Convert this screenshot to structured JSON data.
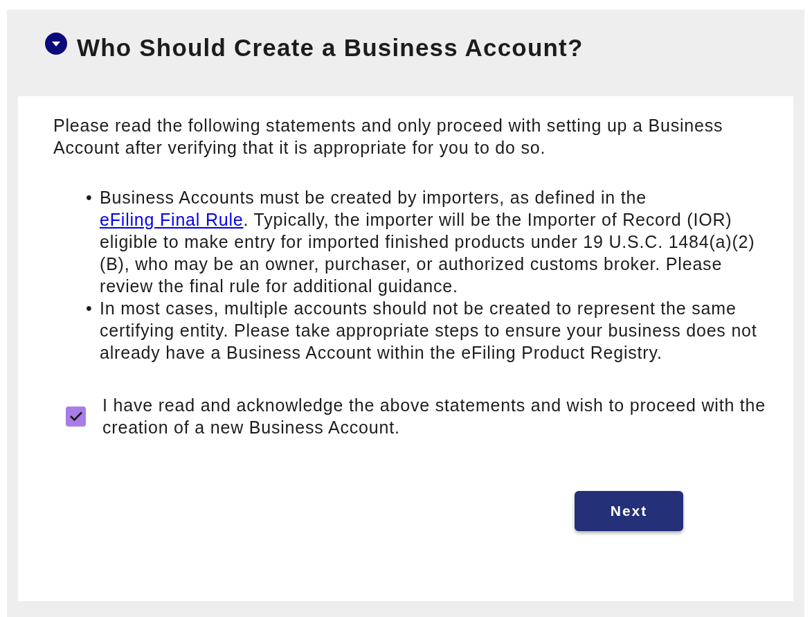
{
  "section": {
    "title": "Who Should Create a Business Account?",
    "expanded": true
  },
  "intro": "Please read the following statements and only proceed with setting up a Business Account after verifying that it is appropriate for you to do so.",
  "statements": [
    {
      "marker": "•",
      "segments": [
        {
          "kind": "text",
          "text": "Business Accounts must be created by importers, as defined in the "
        },
        {
          "kind": "link",
          "text": "eFiling Final Rule"
        },
        {
          "kind": "text",
          "text": ". Typically, the importer will be the Importer of Record (IOR) eligible to make entry for imported finished products under 19 U.S.C. 1484(a)(2)(B), who may be an owner, purchaser, or authorized customs broker. Please review the final rule for additional guidance."
        }
      ]
    },
    {
      "marker": "•",
      "segments": [
        {
          "kind": "text",
          "text": "In most cases, multiple accounts should not be created to represent the same certifying entity. Please take appropriate steps to ensure your business does not already have a Business Account within the eFiling Product Registry."
        }
      ]
    }
  ],
  "acknowledgement": {
    "label": "I have read and acknowledge the above statements and wish to proceed with the creation of a new Business Account.",
    "checked": true
  },
  "next_button": {
    "label": "Next"
  }
}
